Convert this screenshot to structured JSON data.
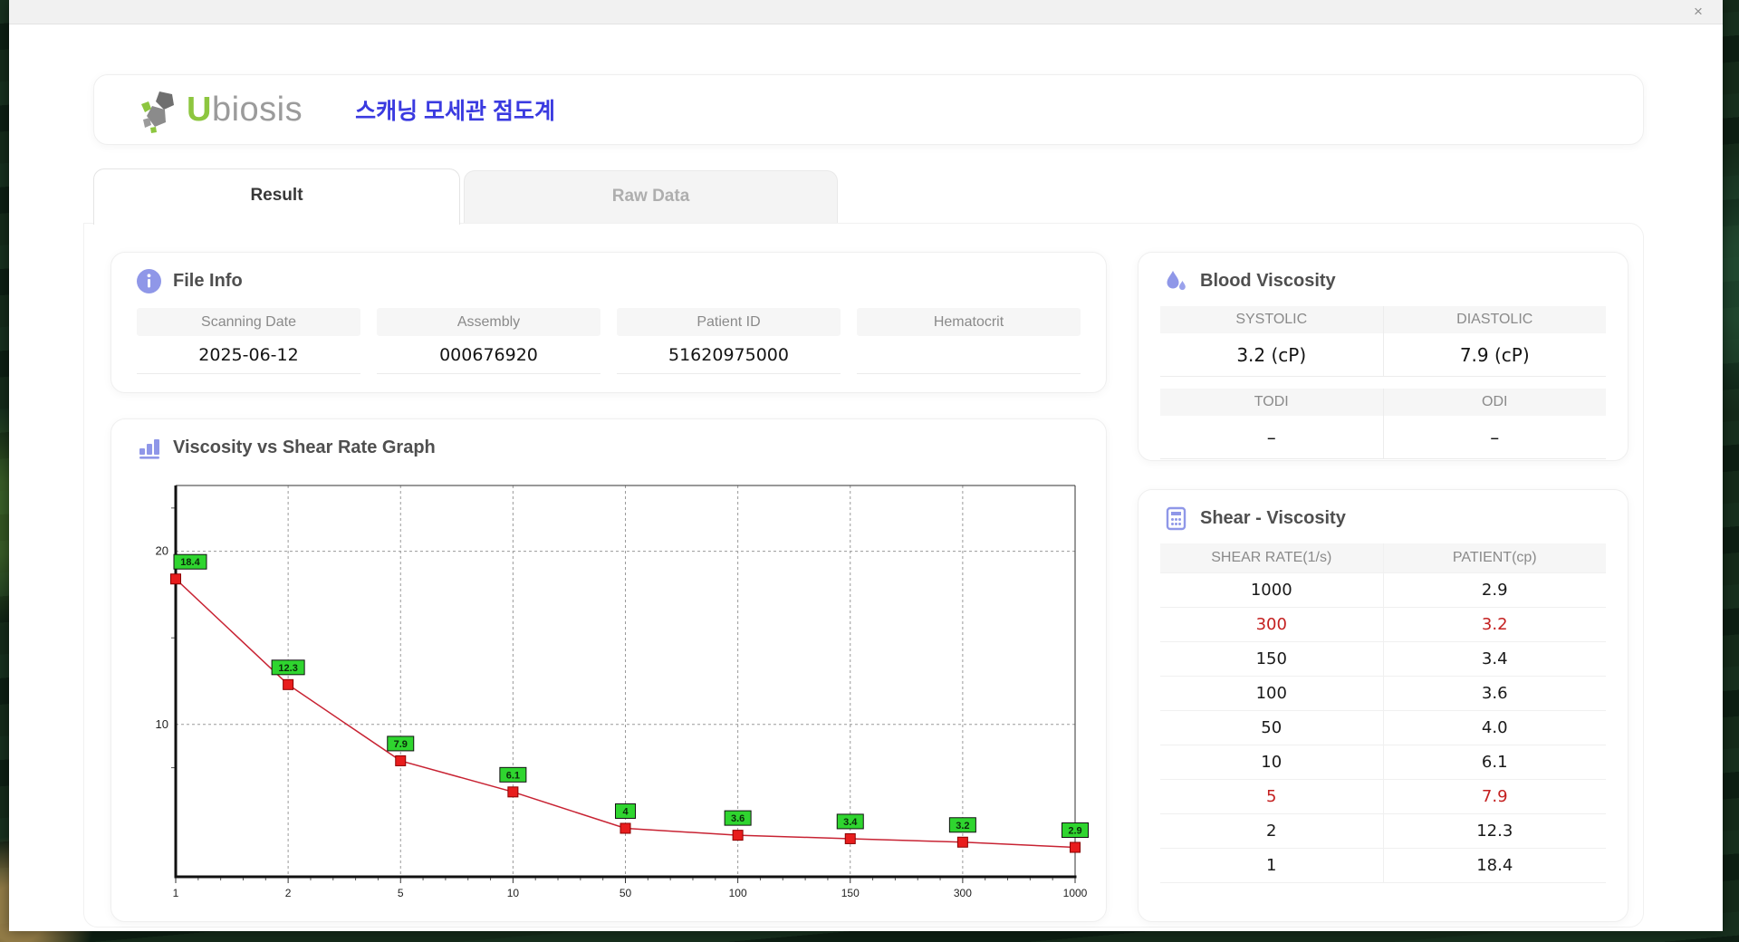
{
  "window": {
    "close_label": "×"
  },
  "header": {
    "logo_u": "U",
    "logo_rest": "biosis",
    "app_title_korean": "스캐닝 모세관 점도계"
  },
  "tabs": [
    {
      "label": "Result",
      "active": true
    },
    {
      "label": "Raw Data",
      "active": false
    }
  ],
  "file_info": {
    "title": "File Info",
    "fields": [
      {
        "label": "Scanning Date",
        "value": "2025-06-12"
      },
      {
        "label": "Assembly",
        "value": "000676920"
      },
      {
        "label": "Patient ID",
        "value": "51620975000"
      },
      {
        "label": "Hematocrit",
        "value": ""
      }
    ]
  },
  "blood_viscosity": {
    "title": "Blood Viscosity",
    "groups": [
      [
        {
          "label": "SYSTOLIC",
          "value": "3.2 (cP)"
        },
        {
          "label": "DIASTOLIC",
          "value": "7.9 (cP)"
        }
      ],
      [
        {
          "label": "TODI",
          "value": "–"
        },
        {
          "label": "ODI",
          "value": "–"
        }
      ]
    ]
  },
  "shear_table": {
    "title": "Shear - Viscosity",
    "columns": [
      "SHEAR RATE(1/s)",
      "PATIENT(cp)"
    ],
    "rows": [
      {
        "shear_rate": "1000",
        "patient": "2.9",
        "highlight": false
      },
      {
        "shear_rate": "300",
        "patient": "3.2",
        "highlight": true
      },
      {
        "shear_rate": "150",
        "patient": "3.4",
        "highlight": false
      },
      {
        "shear_rate": "100",
        "patient": "3.6",
        "highlight": false
      },
      {
        "shear_rate": "50",
        "patient": "4.0",
        "highlight": false
      },
      {
        "shear_rate": "10",
        "patient": "6.1",
        "highlight": false
      },
      {
        "shear_rate": "5",
        "patient": "7.9",
        "highlight": true
      },
      {
        "shear_rate": "2",
        "patient": "12.3",
        "highlight": false
      },
      {
        "shear_rate": "1",
        "patient": "18.4",
        "highlight": false
      }
    ]
  },
  "graph_section": {
    "title": "Viscosity vs Shear Rate Graph"
  },
  "chart_data": {
    "type": "line",
    "title": "Viscosity vs Shear Rate Graph",
    "x": [
      1,
      2,
      5,
      10,
      50,
      100,
      150,
      300,
      1000
    ],
    "x_tick_labels": [
      "1",
      "2",
      "5",
      "10",
      "50",
      "100",
      "150",
      "300",
      "1000"
    ],
    "x_axis_scale": "categorical-even-spacing",
    "values": [
      18.4,
      12.3,
      7.9,
      6.1,
      4,
      3.6,
      3.4,
      3.2,
      2.9
    ],
    "point_labels": [
      "18.4",
      "12.3",
      "7.9",
      "6.1",
      "4",
      "3.6",
      "3.4",
      "3.2",
      "2.9"
    ],
    "xlabel": "",
    "ylabel": "",
    "ylim": [
      1.2,
      23.8
    ],
    "y_major_ticks": [
      10,
      20
    ],
    "y_minor_ticks": [
      7.5,
      15,
      22.5
    ],
    "x_minor_per_segment": 4,
    "grid": "dashed",
    "legend": "none",
    "colors": {
      "line": "#c82333",
      "marker_fill": "#e81d1d",
      "marker_stroke": "#8b0000",
      "label_bg": "#2fd52f",
      "label_border": "#111111",
      "grid": "#9a9a9a",
      "axis": "#111111"
    }
  },
  "theme": {
    "accent_icon": "#8f97e8",
    "title_text": "#4f4f4f",
    "korean_title_blue": "#3a3ae0",
    "logo_green": "#8dc63f",
    "logo_gray": "#9b9b9b",
    "highlight_red": "#c42020"
  }
}
